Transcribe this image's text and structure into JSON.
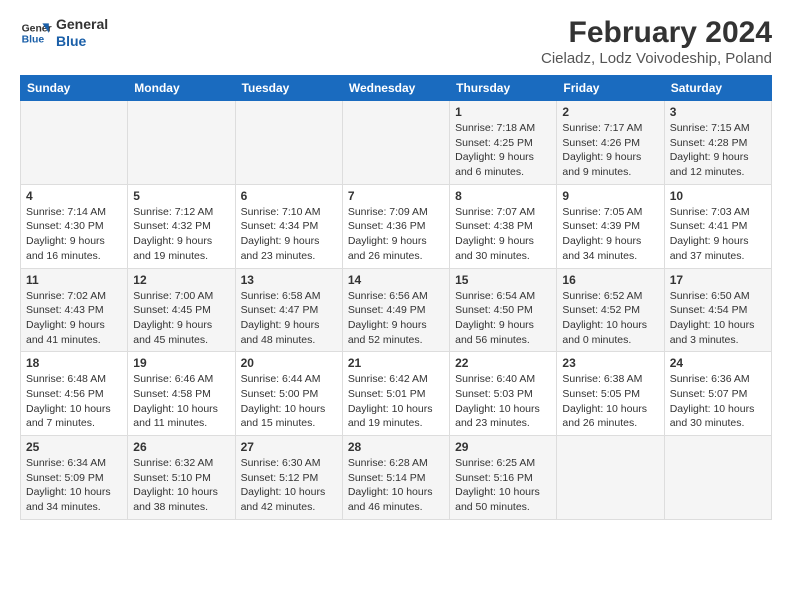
{
  "logo": {
    "line1": "General",
    "line2": "Blue"
  },
  "title": "February 2024",
  "subtitle": "Cieladz, Lodz Voivodeship, Poland",
  "days_of_week": [
    "Sunday",
    "Monday",
    "Tuesday",
    "Wednesday",
    "Thursday",
    "Friday",
    "Saturday"
  ],
  "weeks": [
    [
      {
        "day": "",
        "info": ""
      },
      {
        "day": "",
        "info": ""
      },
      {
        "day": "",
        "info": ""
      },
      {
        "day": "",
        "info": ""
      },
      {
        "day": "1",
        "info": "Sunrise: 7:18 AM\nSunset: 4:25 PM\nDaylight: 9 hours\nand 6 minutes."
      },
      {
        "day": "2",
        "info": "Sunrise: 7:17 AM\nSunset: 4:26 PM\nDaylight: 9 hours\nand 9 minutes."
      },
      {
        "day": "3",
        "info": "Sunrise: 7:15 AM\nSunset: 4:28 PM\nDaylight: 9 hours\nand 12 minutes."
      }
    ],
    [
      {
        "day": "4",
        "info": "Sunrise: 7:14 AM\nSunset: 4:30 PM\nDaylight: 9 hours\nand 16 minutes."
      },
      {
        "day": "5",
        "info": "Sunrise: 7:12 AM\nSunset: 4:32 PM\nDaylight: 9 hours\nand 19 minutes."
      },
      {
        "day": "6",
        "info": "Sunrise: 7:10 AM\nSunset: 4:34 PM\nDaylight: 9 hours\nand 23 minutes."
      },
      {
        "day": "7",
        "info": "Sunrise: 7:09 AM\nSunset: 4:36 PM\nDaylight: 9 hours\nand 26 minutes."
      },
      {
        "day": "8",
        "info": "Sunrise: 7:07 AM\nSunset: 4:38 PM\nDaylight: 9 hours\nand 30 minutes."
      },
      {
        "day": "9",
        "info": "Sunrise: 7:05 AM\nSunset: 4:39 PM\nDaylight: 9 hours\nand 34 minutes."
      },
      {
        "day": "10",
        "info": "Sunrise: 7:03 AM\nSunset: 4:41 PM\nDaylight: 9 hours\nand 37 minutes."
      }
    ],
    [
      {
        "day": "11",
        "info": "Sunrise: 7:02 AM\nSunset: 4:43 PM\nDaylight: 9 hours\nand 41 minutes."
      },
      {
        "day": "12",
        "info": "Sunrise: 7:00 AM\nSunset: 4:45 PM\nDaylight: 9 hours\nand 45 minutes."
      },
      {
        "day": "13",
        "info": "Sunrise: 6:58 AM\nSunset: 4:47 PM\nDaylight: 9 hours\nand 48 minutes."
      },
      {
        "day": "14",
        "info": "Sunrise: 6:56 AM\nSunset: 4:49 PM\nDaylight: 9 hours\nand 52 minutes."
      },
      {
        "day": "15",
        "info": "Sunrise: 6:54 AM\nSunset: 4:50 PM\nDaylight: 9 hours\nand 56 minutes."
      },
      {
        "day": "16",
        "info": "Sunrise: 6:52 AM\nSunset: 4:52 PM\nDaylight: 10 hours\nand 0 minutes."
      },
      {
        "day": "17",
        "info": "Sunrise: 6:50 AM\nSunset: 4:54 PM\nDaylight: 10 hours\nand 3 minutes."
      }
    ],
    [
      {
        "day": "18",
        "info": "Sunrise: 6:48 AM\nSunset: 4:56 PM\nDaylight: 10 hours\nand 7 minutes."
      },
      {
        "day": "19",
        "info": "Sunrise: 6:46 AM\nSunset: 4:58 PM\nDaylight: 10 hours\nand 11 minutes."
      },
      {
        "day": "20",
        "info": "Sunrise: 6:44 AM\nSunset: 5:00 PM\nDaylight: 10 hours\nand 15 minutes."
      },
      {
        "day": "21",
        "info": "Sunrise: 6:42 AM\nSunset: 5:01 PM\nDaylight: 10 hours\nand 19 minutes."
      },
      {
        "day": "22",
        "info": "Sunrise: 6:40 AM\nSunset: 5:03 PM\nDaylight: 10 hours\nand 23 minutes."
      },
      {
        "day": "23",
        "info": "Sunrise: 6:38 AM\nSunset: 5:05 PM\nDaylight: 10 hours\nand 26 minutes."
      },
      {
        "day": "24",
        "info": "Sunrise: 6:36 AM\nSunset: 5:07 PM\nDaylight: 10 hours\nand 30 minutes."
      }
    ],
    [
      {
        "day": "25",
        "info": "Sunrise: 6:34 AM\nSunset: 5:09 PM\nDaylight: 10 hours\nand 34 minutes."
      },
      {
        "day": "26",
        "info": "Sunrise: 6:32 AM\nSunset: 5:10 PM\nDaylight: 10 hours\nand 38 minutes."
      },
      {
        "day": "27",
        "info": "Sunrise: 6:30 AM\nSunset: 5:12 PM\nDaylight: 10 hours\nand 42 minutes."
      },
      {
        "day": "28",
        "info": "Sunrise: 6:28 AM\nSunset: 5:14 PM\nDaylight: 10 hours\nand 46 minutes."
      },
      {
        "day": "29",
        "info": "Sunrise: 6:25 AM\nSunset: 5:16 PM\nDaylight: 10 hours\nand 50 minutes."
      },
      {
        "day": "",
        "info": ""
      },
      {
        "day": "",
        "info": ""
      }
    ]
  ]
}
